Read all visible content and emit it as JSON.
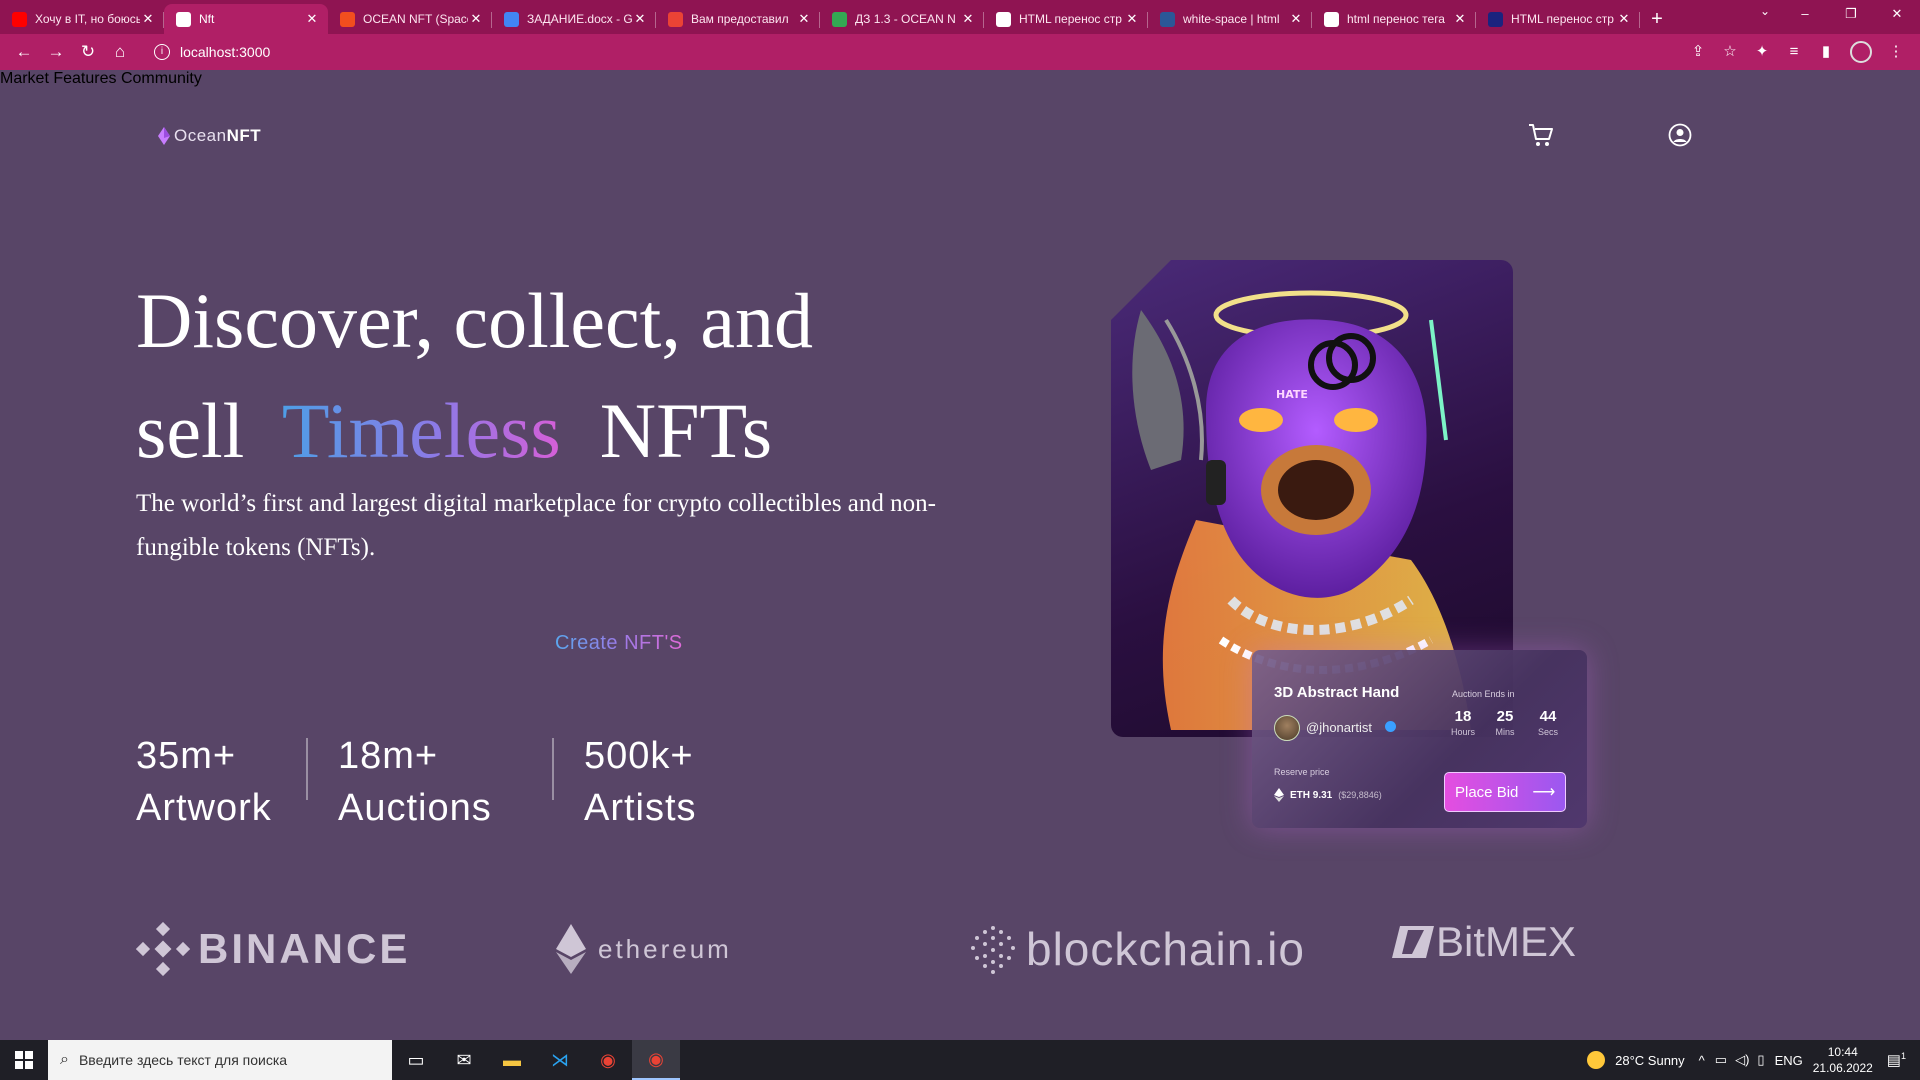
{
  "browser": {
    "tabs": [
      {
        "label": "Хочу в IT, но боюсь",
        "favicon_color": "#ff0000",
        "active": false
      },
      {
        "label": "Nft",
        "favicon_color": "#ffffff",
        "active": true
      },
      {
        "label": "OCEAN NFT (Space",
        "favicon_color": "#f24e1e",
        "active": false
      },
      {
        "label": "ЗАДАНИЕ.docx - G",
        "favicon_color": "#4285f4",
        "active": false
      },
      {
        "label": "Вам предоставил",
        "favicon_color": "#ea4335",
        "active": false
      },
      {
        "label": "ДЗ 1.3 - OCEAN N",
        "favicon_color": "#34a853",
        "active": false
      },
      {
        "label": "HTML перенос стр",
        "favicon_color": "#ffffff",
        "active": false
      },
      {
        "label": "white-space | html",
        "favicon_color": "#2b5797",
        "active": false
      },
      {
        "label": "html перенос тега",
        "favicon_color": "#ffffff",
        "active": false
      },
      {
        "label": "HTML перенос стр",
        "favicon_color": "#1a237e",
        "active": false
      }
    ],
    "new_tab": "+",
    "url": "localhost:3000",
    "window_controls": {
      "minimize": "–",
      "maximize": "❐",
      "close": "✕"
    }
  },
  "site": {
    "logo": {
      "part1": "Ocean",
      "part2": "NFT"
    },
    "nav": [
      "Market",
      "Features",
      "Community"
    ],
    "hero": {
      "line1": "Discover, collect, and",
      "line2_pre": "sell",
      "line2_accent": "Timeless",
      "line2_post": "NFTs",
      "subtitle": "The world’s first and largest digital marketplace for crypto collectibles and non- fungible tokens (NFTs)."
    },
    "cta": "Create NFT'S",
    "stats": [
      {
        "value": "35m+",
        "label": "Artwork"
      },
      {
        "value": "18m+",
        "label": "Auctions"
      },
      {
        "value": "500k+",
        "label": "Artists"
      }
    ],
    "partners": [
      "BINANCE",
      "ethereum",
      "blockchain.io",
      "BitMEX"
    ],
    "auction": {
      "title": "3D Abstract Hand",
      "handle": "@jhonartist",
      "ends_label": "Auction Ends in",
      "countdown": [
        {
          "value": "18",
          "unit": "Hours"
        },
        {
          "value": "25",
          "unit": "Mins"
        },
        {
          "value": "44",
          "unit": "Secs"
        }
      ],
      "reserve_label": "Reserve price",
      "eth_price": "ETH 9.31",
      "usd_price": "($29,8846)",
      "bid_label": "Place Bid"
    }
  },
  "taskbar": {
    "search_placeholder": "Введите здесь текст для поиска",
    "weather": "28°C  Sunny",
    "lang": "ENG",
    "time": "10:44",
    "date": "21.06.2022",
    "notifications": "1"
  }
}
